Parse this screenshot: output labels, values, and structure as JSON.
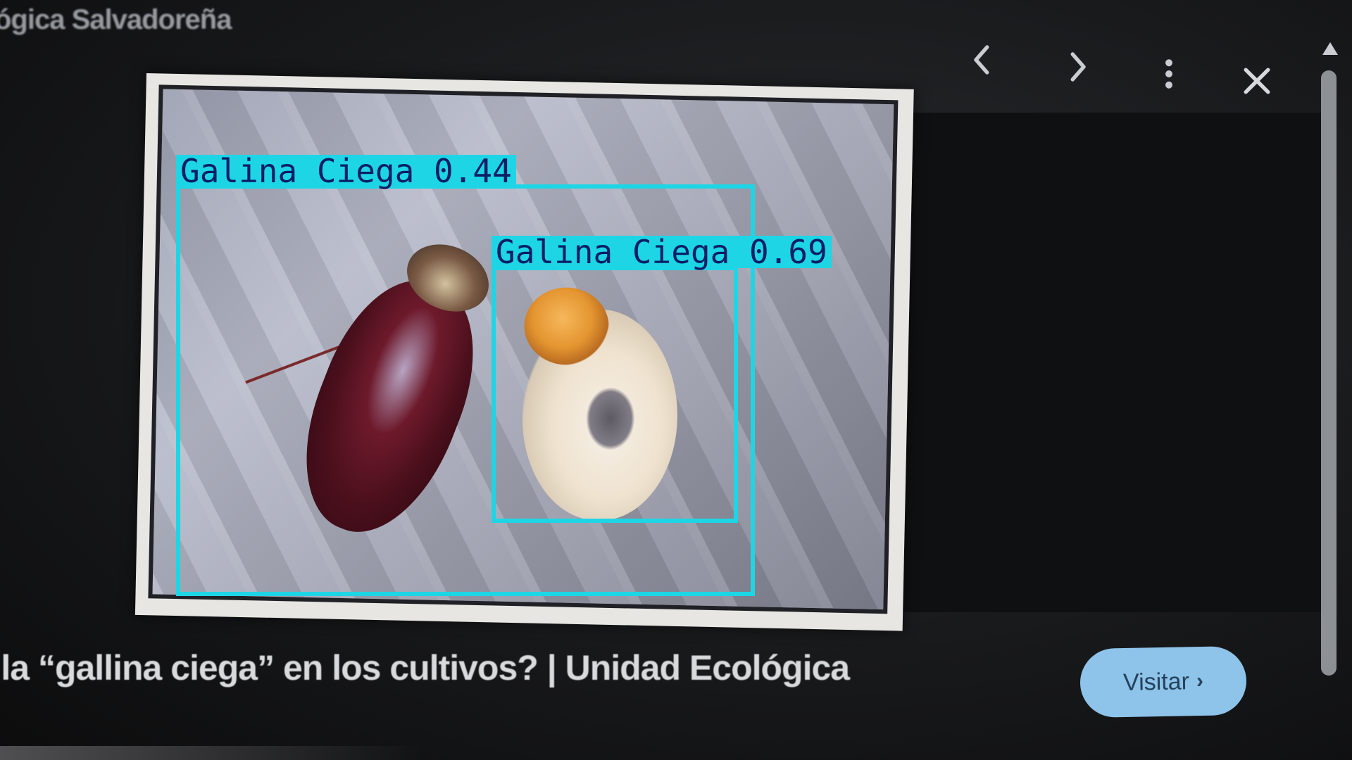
{
  "viewer": {
    "source_name": "ógica Salvadoreña",
    "caption": "r la “gallina ciega” en los cultivos? | Unidad Ecológica",
    "visit_label": "Visitar",
    "icons": {
      "prev": "chevron-left-icon",
      "next": "chevron-right-icon",
      "more": "more-vert-icon",
      "close": "close-icon",
      "visit_arrow": "chevron-right-icon"
    }
  },
  "detections": [
    {
      "label": "Galina Ciega 0.44"
    },
    {
      "label": "Galina Ciega 0.69"
    }
  ],
  "colors": {
    "bbox": "#1ed5e6",
    "bbox_text": "#0a1e66",
    "visit_button": "#8ec3ea"
  }
}
